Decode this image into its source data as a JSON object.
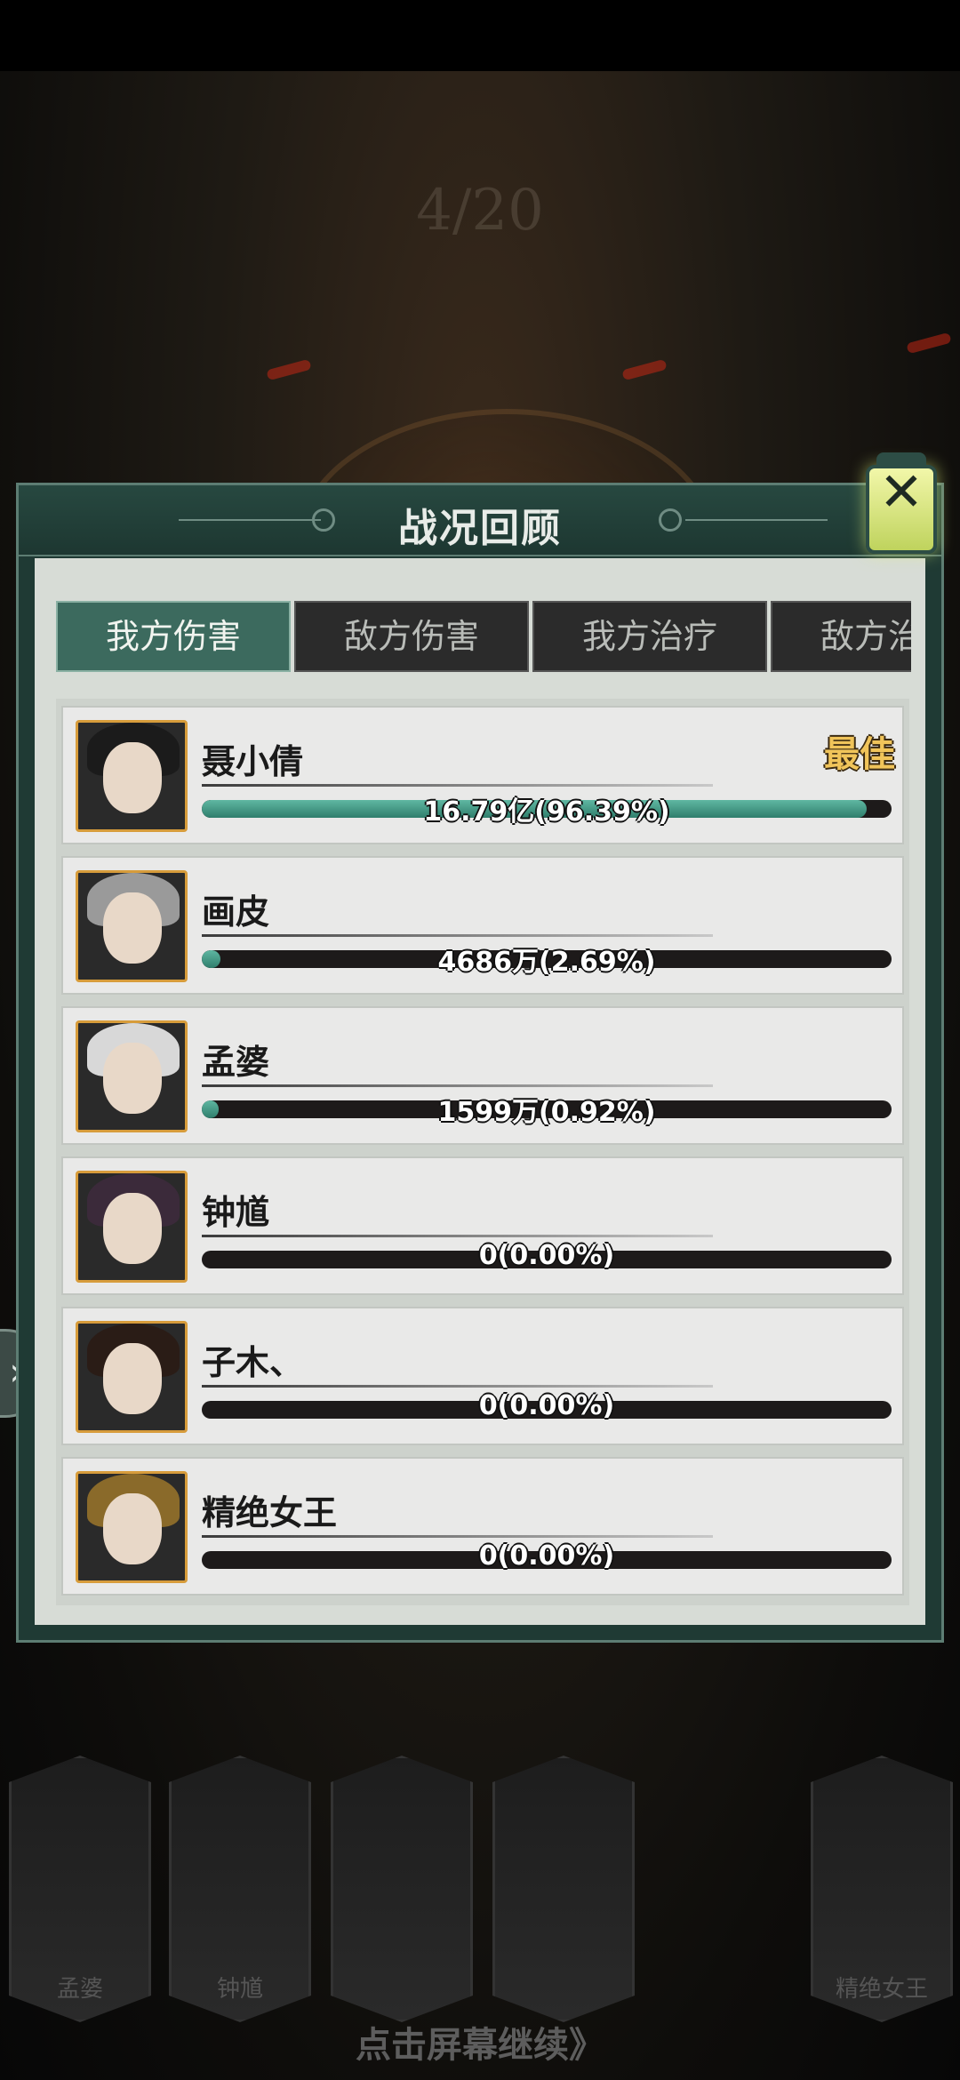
{
  "background": {
    "round_counter": "4/20",
    "continue_text": "点击屏幕继续》",
    "heroes": [
      {
        "name": "孟婆"
      },
      {
        "name": "钟馗"
      },
      {
        "name": ""
      },
      {
        "name": ""
      },
      {
        "name": "精绝女王"
      }
    ]
  },
  "panel": {
    "title": "战况回顾",
    "close_label": "✕",
    "tabs": [
      {
        "label": "我方伤害",
        "active": true
      },
      {
        "label": "敌方伤害",
        "active": false
      },
      {
        "label": "我方治疗",
        "active": false
      },
      {
        "label": "敌方治疗",
        "active": false
      }
    ],
    "best_label": "最佳",
    "rows": [
      {
        "name": "聂小倩",
        "value_text": "16.79亿(96.39%)",
        "fraction": 0.9639,
        "best": true,
        "hair": "#1b1b1b"
      },
      {
        "name": "画皮",
        "value_text": "4686万(2.69%)",
        "fraction": 0.0269,
        "best": false,
        "hair": "#9a9a9a"
      },
      {
        "name": "孟婆",
        "value_text": "1599万(0.92%)",
        "fraction": 0.0092,
        "best": false,
        "hair": "#d8d8d8"
      },
      {
        "name": "钟馗",
        "value_text": "0(0.00%)",
        "fraction": 0,
        "best": false,
        "hair": "#3b2a3a"
      },
      {
        "name": "子木、",
        "value_text": "0(0.00%)",
        "fraction": 0,
        "best": false,
        "hair": "#2a1c16"
      },
      {
        "name": "精绝女王",
        "value_text": "0(0.00%)",
        "fraction": 0,
        "best": false,
        "hair": "#8a6a2a"
      }
    ]
  },
  "colors": {
    "panel": "#1f3a34",
    "active_tab": "#3c6a5e",
    "bar_fill": "#4a9c88",
    "best": "#f0c45a",
    "avatar_border": "#d79c3b"
  }
}
